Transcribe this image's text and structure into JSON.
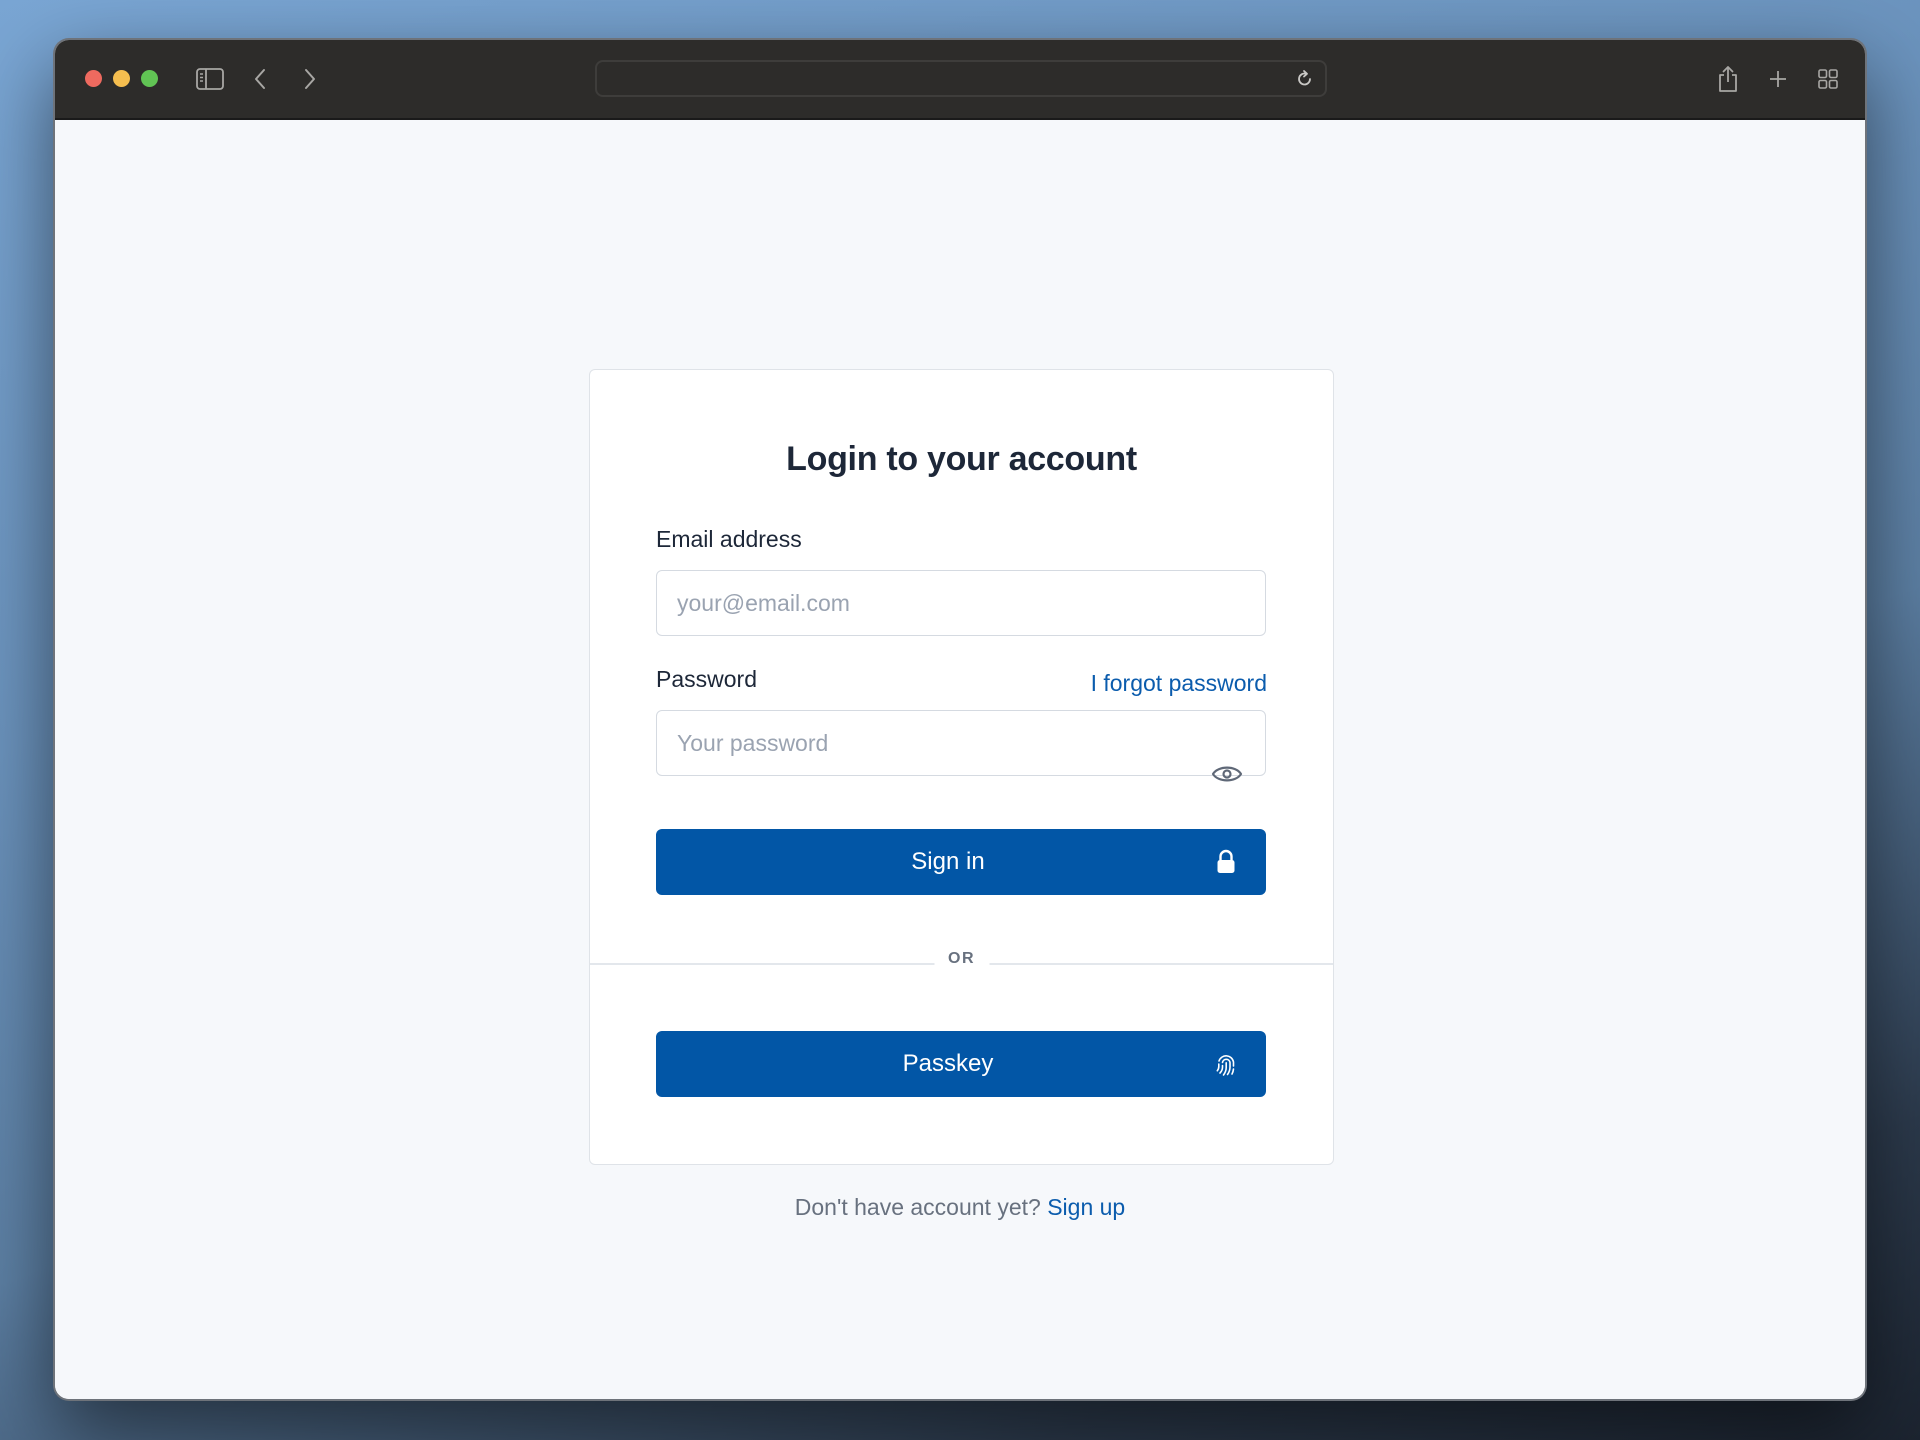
{
  "browser": {
    "url": "",
    "icons": {
      "sidebar": "sidebar-icon",
      "back": "chevron-left-icon",
      "forward": "chevron-right-icon",
      "reload": "reload-icon",
      "share": "share-icon",
      "new_tab": "plus-icon",
      "tab_overview": "grid-icon"
    }
  },
  "login": {
    "title": "Login to your account",
    "email": {
      "label": "Email address",
      "value": "",
      "placeholder": "your@email.com"
    },
    "password": {
      "label": "Password",
      "forgot_link": "I forgot password",
      "value": "",
      "placeholder": "Your password",
      "toggle_icon": "eye-icon"
    },
    "sign_in_button": {
      "label": "Sign in",
      "icon": "lock-icon"
    },
    "divider_text": "OR",
    "passkey_button": {
      "label": "Passkey",
      "icon": "fingerprint-icon"
    },
    "footer": {
      "prompt": "Don't have account yet?",
      "signup_link": "Sign up"
    }
  },
  "colors": {
    "primary": "#0256a6",
    "link": "#0b5cad",
    "text": "#1d2738",
    "muted": "#68717f",
    "page_bg": "#f6f8fb"
  }
}
